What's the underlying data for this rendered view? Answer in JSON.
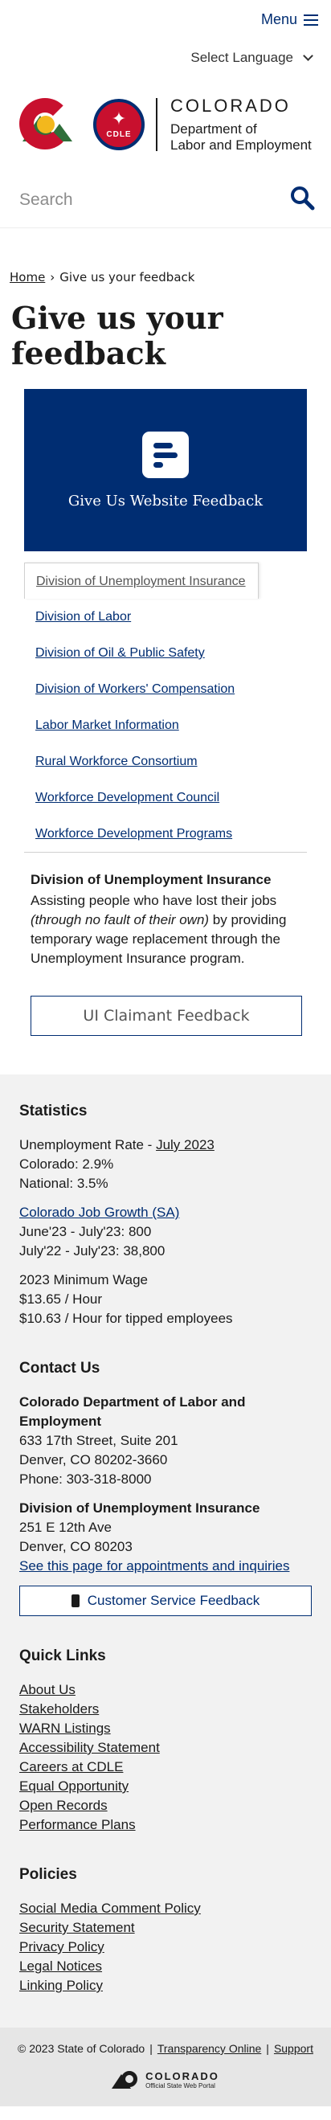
{
  "header": {
    "menu_label": "Menu",
    "language_label": "Select Language",
    "logo_state": "COLORADO",
    "logo_dept_line1": "Department of",
    "logo_dept_line2": "Labor and Employment",
    "cdle_badge": "CDLE",
    "search_placeholder": "Search"
  },
  "breadcrumb": {
    "home": "Home",
    "separator": "›",
    "current": "Give us your feedback"
  },
  "page_title": "Give us your feedback",
  "feedback_card": {
    "label": "Give Us Website Feedback"
  },
  "tabs": [
    {
      "label": "Division of Unemployment Insurance",
      "active": true
    },
    {
      "label": "Division of Labor"
    },
    {
      "label": "Division of Oil & Public Safety"
    },
    {
      "label": "Division of Workers' Compensation"
    },
    {
      "label": "Labor Market Information"
    },
    {
      "label": "Rural Workforce Consortium"
    },
    {
      "label": "Workforce Development Council"
    },
    {
      "label": "Workforce Development Programs"
    }
  ],
  "panel": {
    "heading": "Division of Unemployment Insurance",
    "text_before": "Assisting people who have lost their jobs ",
    "text_italic": "(through no fault of their own)",
    "text_after": " by providing temporary wage replacement through the Unemployment Insurance program.",
    "button_label": "UI Claimant Feedback"
  },
  "footer": {
    "statistics": {
      "title": "Statistics",
      "unemployment_label": "Unemployment Rate - ",
      "unemployment_link": "July 2023",
      "colorado": "Colorado: 2.9%",
      "national": "National: 3.5%",
      "growth_link": "Colorado Job Growth (SA)",
      "growth_line1": "June'23 - July'23: 800",
      "growth_line2": "July'22 - July'23: 38,800",
      "wage_title": "2023 Minimum Wage",
      "wage_line1": "$13.65 / Hour",
      "wage_line2": "$10.63 / Hour for tipped employees"
    },
    "contact": {
      "title": "Contact Us",
      "org": "Colorado Department of Labor and Employment",
      "address1": "633 17th Street, Suite 201",
      "address2": "Denver, CO  80202-3660",
      "phone": "Phone: 303-318-8000",
      "ui_org": "Division of Unemployment Insurance",
      "ui_address1": "251 E 12th Ave",
      "ui_address2": "Denver, CO  80203",
      "appointments_link": "See this page for appointments and inquiries",
      "cs_button": "Customer Service Feedback"
    },
    "quick_links": {
      "title": "Quick Links",
      "items": [
        "About Us",
        "Stakeholders",
        "WARN Listings",
        "Accessibility Statement",
        "Careers at CDLE",
        "Equal Opportunity",
        "Open Records",
        "Performance Plans"
      ]
    },
    "policies": {
      "title": "Policies",
      "items": [
        "Social Media Comment Policy",
        "Security Statement",
        "Privacy Policy",
        "Legal Notices",
        "Linking Policy"
      ]
    }
  },
  "bottom": {
    "copyright": "© 2023 State of Colorado",
    "sep": "|",
    "transparency": "Transparency Online",
    "support": "Support",
    "portal_line1": "COLORADO",
    "portal_line2": "Official State Web Portal"
  },
  "colors": {
    "brand_blue": "#002d72",
    "brand_red": "#c8102e",
    "footer_bg": "#f2f2f2"
  }
}
